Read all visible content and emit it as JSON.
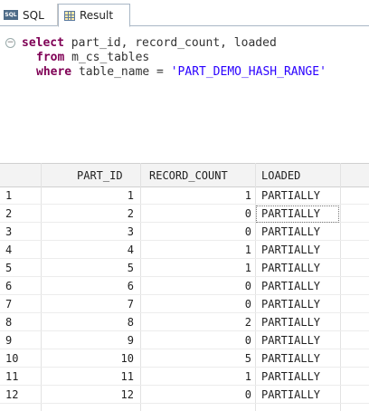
{
  "tabs": {
    "sql": {
      "icon_text": "SQL",
      "label": "SQL"
    },
    "result": {
      "label": "Result"
    }
  },
  "editor": {
    "line1": {
      "kw": "select",
      "rest": " part_id, record_count, loaded"
    },
    "line2": {
      "kw": "from",
      "rest": " m_cs_tables"
    },
    "line3": {
      "kw": "where",
      "rest": " table_name = ",
      "str": "'PART_DEMO_HASH_RANGE'"
    }
  },
  "table": {
    "columns": [
      "",
      "PART_ID",
      "RECORD_COUNT",
      "LOADED"
    ],
    "rows": [
      [
        "1",
        "1",
        "1",
        "PARTIALLY"
      ],
      [
        "2",
        "2",
        "0",
        "PARTIALLY"
      ],
      [
        "3",
        "3",
        "0",
        "PARTIALLY"
      ],
      [
        "4",
        "4",
        "1",
        "PARTIALLY"
      ],
      [
        "5",
        "5",
        "1",
        "PARTIALLY"
      ],
      [
        "6",
        "6",
        "0",
        "PARTIALLY"
      ],
      [
        "7",
        "7",
        "0",
        "PARTIALLY"
      ],
      [
        "8",
        "8",
        "2",
        "PARTIALLY"
      ],
      [
        "9",
        "9",
        "0",
        "PARTIALLY"
      ],
      [
        "10",
        "10",
        "5",
        "PARTIALLY"
      ],
      [
        "11",
        "11",
        "1",
        "PARTIALLY"
      ],
      [
        "12",
        "12",
        "0",
        "PARTIALLY"
      ]
    ],
    "focused_row_index": 1
  }
}
